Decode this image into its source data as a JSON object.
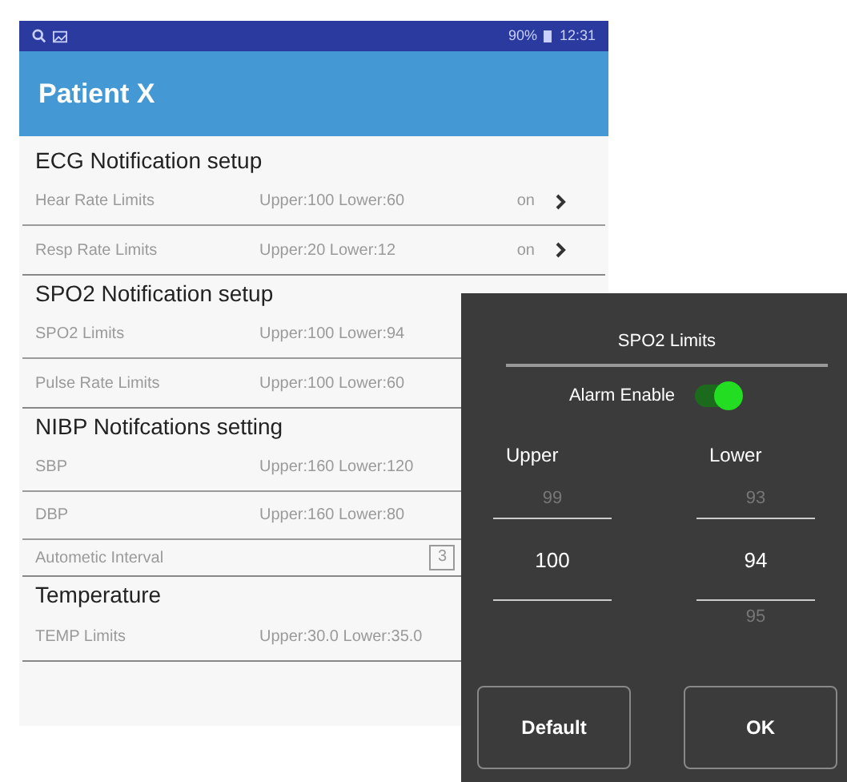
{
  "status_bar": {
    "battery": "90%",
    "time": "12:31"
  },
  "app_bar": {
    "title": "Patient X"
  },
  "sections": [
    {
      "title": "ECG Notification setup",
      "rows": [
        {
          "kind": "limit",
          "label": "Hear Rate Limits",
          "value": "Upper:100 Lower:60",
          "state": "on"
        },
        {
          "kind": "limit",
          "label": "Resp Rate Limits",
          "value": "Upper:20 Lower:12",
          "state": "on"
        }
      ]
    },
    {
      "title": "SPO2 Notification setup",
      "rows": [
        {
          "kind": "limit",
          "label": "SPO2 Limits",
          "value": "Upper:100 Lower:94"
        },
        {
          "kind": "limit",
          "label": "Pulse Rate Limits",
          "value": "Upper:100 Lower:60"
        }
      ]
    },
    {
      "title": "NIBP Notifcations setting",
      "rows": [
        {
          "kind": "limit",
          "label": "SBP",
          "value": "Upper:160 Lower:120"
        },
        {
          "kind": "limit",
          "label": "DBP",
          "value": "Upper:160 Lower:80"
        },
        {
          "kind": "dropdown",
          "label": "Autometic Interval",
          "value": "3"
        }
      ]
    },
    {
      "title": "Temperature",
      "rows": [
        {
          "kind": "limit",
          "label": "TEMP Limits",
          "value": "Upper:30.0 Lower:35.0"
        }
      ]
    }
  ],
  "dialog": {
    "title": "SPO2 Limits",
    "alarm_label": "Alarm Enable",
    "alarm_on": true,
    "columns": [
      {
        "label": "Upper",
        "above": "99",
        "value": "100"
      },
      {
        "label": "Lower",
        "above": "93",
        "value": "94",
        "below": "95"
      }
    ],
    "buttons": [
      "Default",
      "OK"
    ]
  }
}
